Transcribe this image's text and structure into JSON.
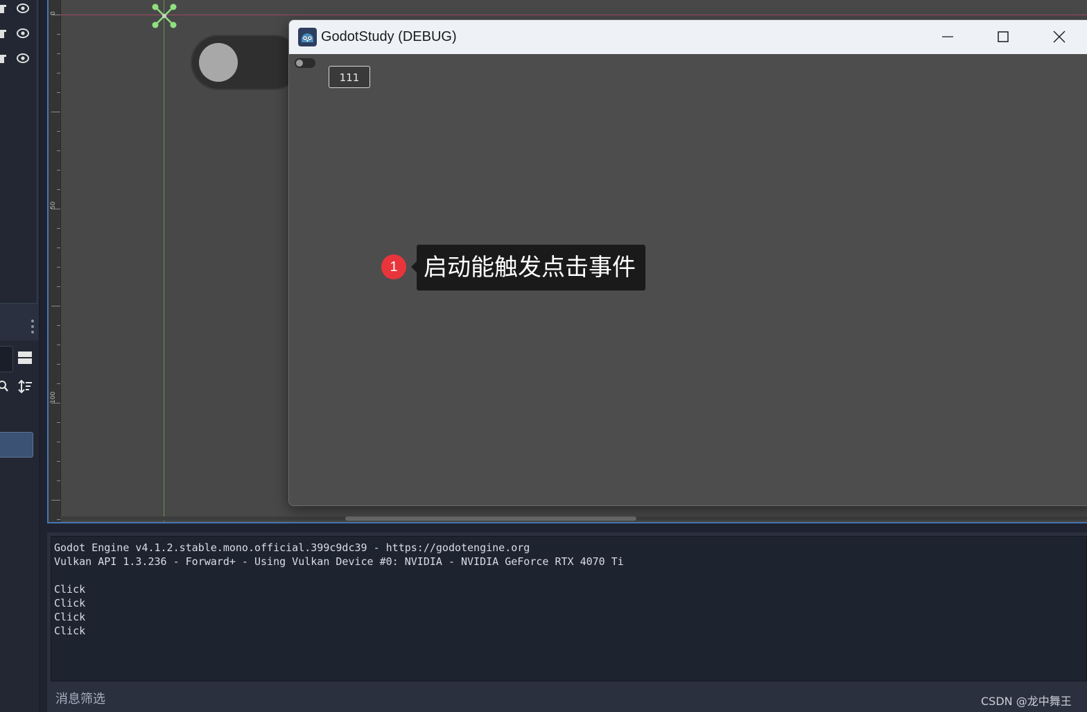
{
  "ruler": {
    "marks": [
      "0",
      "50",
      "100"
    ]
  },
  "game_window": {
    "title": "GodotStudy (DEBUG)",
    "button_label": "111",
    "toggle_state": "off"
  },
  "annotation": {
    "badge": "1",
    "text": "启动能触发点击事件"
  },
  "output": {
    "lines": [
      "Godot Engine v4.1.2.stable.mono.official.399c9dc39 - https://godotengine.org",
      "Vulkan API 1.3.236 - Forward+ - Using Vulkan Device #0: NVIDIA - NVIDIA GeForce RTX 4070 Ti",
      "",
      "Click",
      "Click",
      "Click",
      "Click"
    ],
    "filter_placeholder": "消息筛选"
  },
  "watermark": "CSDN @龙中舞王",
  "colors": {
    "viewport_bg": "#484848",
    "selection_border": "#4577b6",
    "annotation_badge": "#e8353b",
    "guide_x": "#b34a63",
    "guide_y": "#6c9c55",
    "anchor_gizmo": "#8fe07f"
  }
}
